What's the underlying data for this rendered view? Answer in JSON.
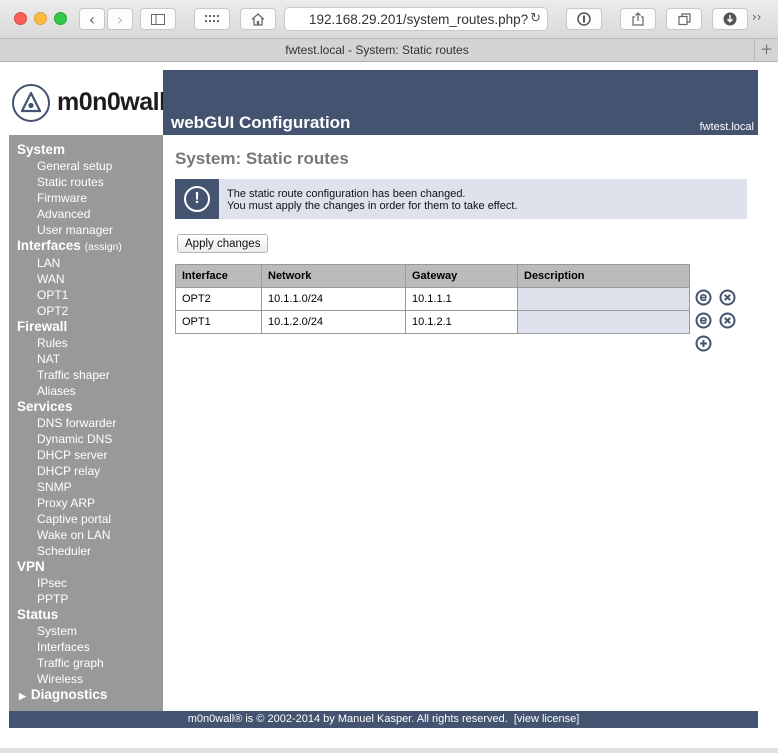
{
  "browser": {
    "url": "192.168.29.201/system_routes.php?",
    "tab_title": "fwtest.local - System: Static routes",
    "back": "‹",
    "forward": "›",
    "reload": "↻",
    "more": "››",
    "plus": "+"
  },
  "header": {
    "logo_text": "m0n0wall",
    "logo_mark": "®",
    "title": "webGUI Configuration",
    "hostname": "fwtest.local"
  },
  "sidebar": {
    "system": {
      "label": "System",
      "items": [
        "General setup",
        "Static routes",
        "Firmware",
        "Advanced",
        "User manager"
      ]
    },
    "interfaces": {
      "label": "Interfaces",
      "assign": "(assign)",
      "items": [
        "LAN",
        "WAN",
        "OPT1",
        "OPT2"
      ]
    },
    "firewall": {
      "label": "Firewall",
      "items": [
        "Rules",
        "NAT",
        "Traffic shaper",
        "Aliases"
      ]
    },
    "services": {
      "label": "Services",
      "items": [
        "DNS forwarder",
        "Dynamic DNS",
        "DHCP server",
        "DHCP relay",
        "SNMP",
        "Proxy ARP",
        "Captive portal",
        "Wake on LAN",
        "Scheduler"
      ]
    },
    "vpn": {
      "label": "VPN",
      "items": [
        "IPsec",
        "PPTP"
      ]
    },
    "status": {
      "label": "Status",
      "items": [
        "System",
        "Interfaces",
        "Traffic graph",
        "Wireless"
      ]
    },
    "diagnostics": {
      "label": "Diagnostics"
    }
  },
  "main": {
    "page_title": "System: Static routes",
    "alert": {
      "icon": "!",
      "line1": "The static route configuration has been changed.",
      "line2": "You must apply the changes in order for them to take effect."
    },
    "apply_label": "Apply changes",
    "table": {
      "headers": [
        "Interface",
        "Network",
        "Gateway",
        "Description"
      ],
      "rows": [
        [
          "OPT2",
          "10.1.1.0/24",
          "10.1.1.1",
          ""
        ],
        [
          "OPT1",
          "10.1.2.0/24",
          "10.1.2.1",
          ""
        ]
      ]
    }
  },
  "footer": {
    "copyright": "m0n0wall® is © 2002-2014 by Manuel Kasper. All rights reserved.",
    "license": "[view license]"
  },
  "colors": {
    "brand_blue": "#435370",
    "sidebar_gray": "#999999",
    "alert_bg": "#dde2ec"
  }
}
